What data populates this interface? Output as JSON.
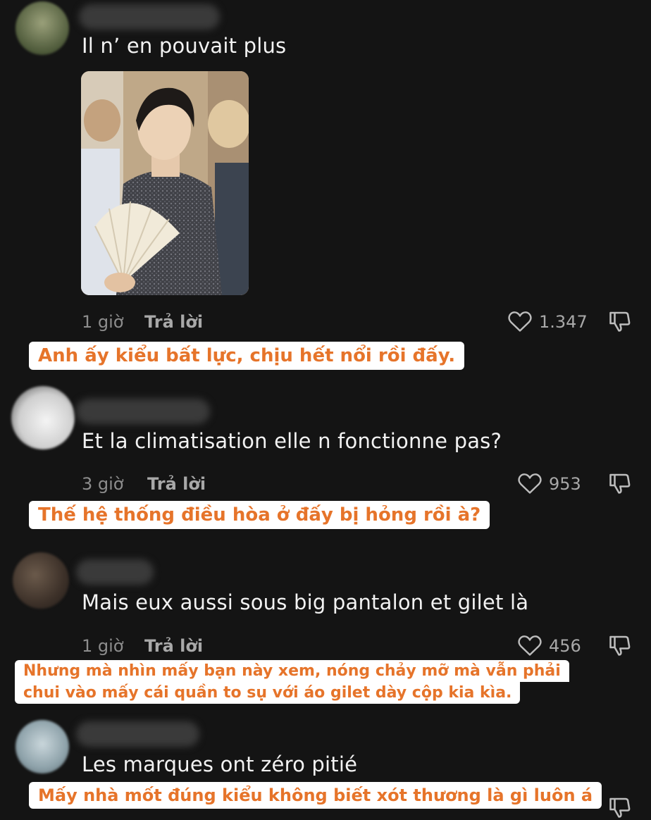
{
  "comments": [
    {
      "text": "Il n’ en pouvait plus",
      "time": "1 giờ",
      "reply": "Trả lời",
      "likes": "1.347",
      "translation": "Anh ấy kiểu bất lực, chịu hết nổi rồi đấy."
    },
    {
      "text": "Et la climatisation elle n fonctionne pas?",
      "time": "3 giờ",
      "reply": "Trả lời",
      "likes": "953",
      "translation": "Thế hệ thống điều hòa ở đấy bị hỏng rồi à?"
    },
    {
      "text": "Mais eux aussi sous big pantalon et gilet là",
      "time": "1 giờ",
      "reply": "Trả lời",
      "likes": "456",
      "translation_lines": [
        "Nhưng mà nhìn mấy bạn này xem, nóng chảy mỡ mà vẫn phải",
        "chui vào mấy cái quần to sụ với áo gilet dày cộp kia kìa."
      ]
    },
    {
      "text": "Les marques ont zéro pitié",
      "translation": "Mấy nhà mốt đúng kiểu không biết xót thương là gì luôn á"
    }
  ],
  "icons": {
    "like": "heart-outline-icon",
    "dislike": "thumbs-down-icon"
  },
  "colors": {
    "background": "#141414",
    "overlay_text": "#e6742a",
    "overlay_bg": "#ffffff"
  }
}
